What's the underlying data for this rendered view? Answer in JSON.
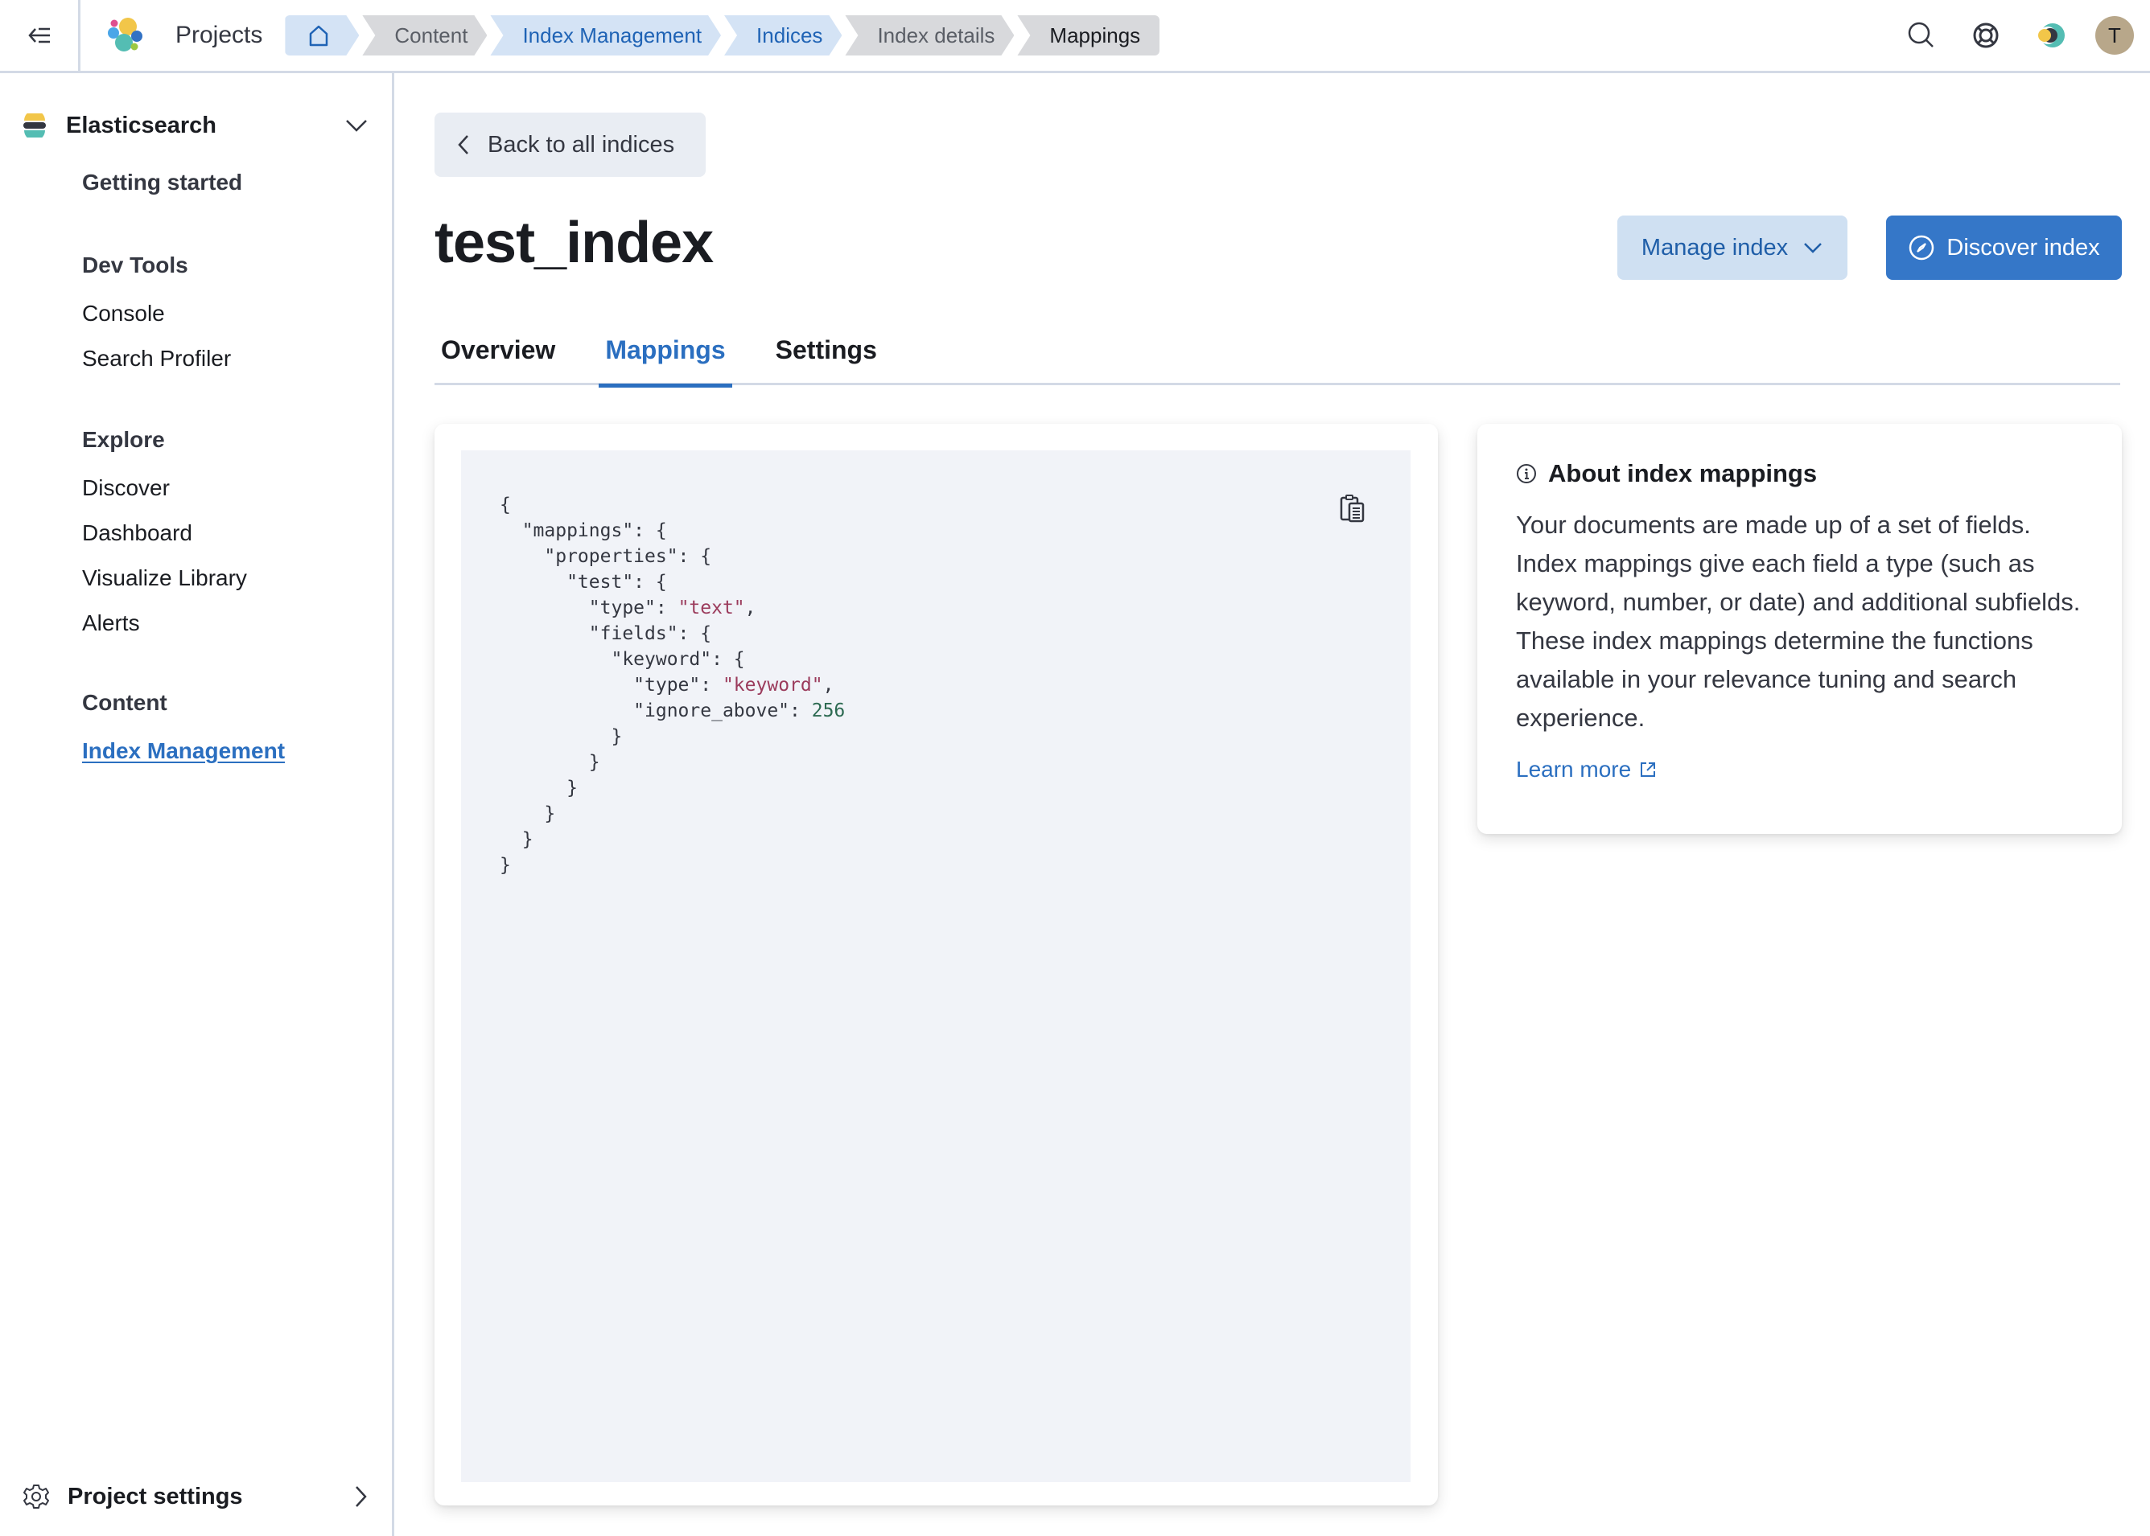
{
  "header": {
    "projects_label": "Projects",
    "breadcrumbs": [
      {
        "label": "",
        "icon": "home-icon",
        "style": "blue"
      },
      {
        "label": "Content",
        "style": "gray"
      },
      {
        "label": "Index Management",
        "style": "blue"
      },
      {
        "label": "Indices",
        "style": "blue"
      },
      {
        "label": "Index details",
        "style": "gray"
      },
      {
        "label": "Mappings",
        "style": "current"
      }
    ],
    "icons": [
      "search-icon",
      "help-icon",
      "theme-toggle-icon"
    ],
    "avatar_initial": "T"
  },
  "sidebar": {
    "solution_title": "Elasticsearch",
    "getting_started": "Getting started",
    "sections": [
      {
        "heading": "Dev Tools",
        "items": [
          "Console",
          "Search Profiler"
        ]
      },
      {
        "heading": "Explore",
        "items": [
          "Discover",
          "Dashboard",
          "Visualize Library",
          "Alerts"
        ]
      },
      {
        "heading": "Content",
        "items": [
          "Index Management"
        ]
      }
    ],
    "active_item": "Index Management",
    "footer_label": "Project settings"
  },
  "main": {
    "back_label": "Back to all indices",
    "title": "test_index",
    "manage_label": "Manage index",
    "discover_label": "Discover index",
    "tabs": [
      "Overview",
      "Mappings",
      "Settings"
    ],
    "active_tab": "Mappings",
    "mappings_json": {
      "lines": [
        [
          {
            "t": "{",
            "c": "p"
          }
        ],
        [
          {
            "t": "  \"mappings\": {",
            "c": "p"
          }
        ],
        [
          {
            "t": "    \"properties\": {",
            "c": "p"
          }
        ],
        [
          {
            "t": "      \"test\": {",
            "c": "p"
          }
        ],
        [
          {
            "t": "        \"type\": ",
            "c": "p"
          },
          {
            "t": "\"text\"",
            "c": "str"
          },
          {
            "t": ",",
            "c": "p"
          }
        ],
        [
          {
            "t": "        \"fields\": {",
            "c": "p"
          }
        ],
        [
          {
            "t": "          \"keyword\": {",
            "c": "p"
          }
        ],
        [
          {
            "t": "            \"type\": ",
            "c": "p"
          },
          {
            "t": "\"keyword\"",
            "c": "str"
          },
          {
            "t": ",",
            "c": "p"
          }
        ],
        [
          {
            "t": "            \"ignore_above\": ",
            "c": "p"
          },
          {
            "t": "256",
            "c": "num"
          }
        ],
        [
          {
            "t": "          }",
            "c": "p"
          }
        ],
        [
          {
            "t": "        }",
            "c": "p"
          }
        ],
        [
          {
            "t": "      }",
            "c": "p"
          }
        ],
        [
          {
            "t": "    }",
            "c": "p"
          }
        ],
        [
          {
            "t": "  }",
            "c": "p"
          }
        ],
        [
          {
            "t": "}",
            "c": "p"
          }
        ]
      ]
    },
    "info": {
      "title": "About index mappings",
      "body": "Your documents are made up of a set of fields. Index mappings give each field a type (such as keyword, number, or date) and additional subfields. These index mappings determine the functions available in your relevance tuning and search experience.",
      "learn_more": "Learn more"
    }
  },
  "colors": {
    "accent": "#2b6fc0",
    "primary_button": "#3577c8",
    "secondary_button": "#cfe0f2",
    "code_bg": "#f1f3f8",
    "json_string": "#9b3b5c",
    "json_number": "#2d6a52"
  }
}
